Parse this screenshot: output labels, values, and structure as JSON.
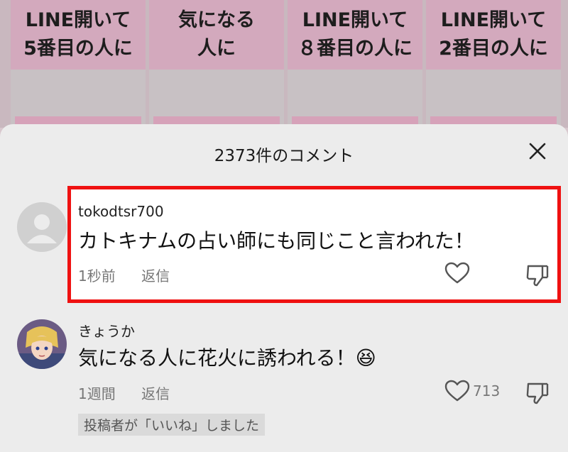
{
  "background_cards": [
    {
      "line1": "LINE開いて",
      "line2": "5番目の人に"
    },
    {
      "line1": "気になる",
      "line2": "人に"
    },
    {
      "line1": "LINE開いて",
      "line2": "８番目の人に"
    },
    {
      "line1": "LINE開いて",
      "line2": "2番目の人に"
    }
  ],
  "sheet": {
    "title": "2373件のコメント",
    "close_icon": "close-icon"
  },
  "comments": [
    {
      "username": "tokodtsr700",
      "text": "カトキナムの占い師にも同じこと言われた！",
      "time": "1秒前",
      "reply_label": "返信",
      "like_count": ""
    },
    {
      "username": "きょうか",
      "text": "気になる人に花火に誘われる！😆",
      "time": "1週間",
      "reply_label": "返信",
      "like_count": "713",
      "creator_badge": "投稿者が「いいね」しました"
    }
  ],
  "colors": {
    "highlight_border": "#ef1111",
    "sheet_bg": "#ececec"
  }
}
